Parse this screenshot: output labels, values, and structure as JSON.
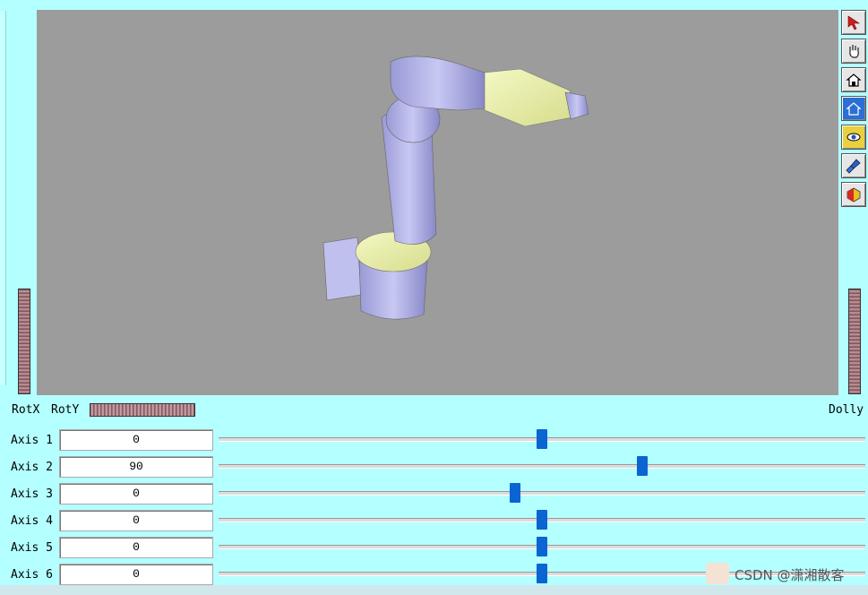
{
  "viewer": {
    "labels": {
      "rotx": "RotX",
      "roty": "RotY",
      "dolly": "Dolly"
    },
    "toolbar": [
      {
        "name": "select-arrow-icon"
      },
      {
        "name": "pan-hand-icon"
      },
      {
        "name": "home-icon"
      },
      {
        "name": "set-home-icon"
      },
      {
        "name": "view-all-eye-icon"
      },
      {
        "name": "seek-flashlight-icon"
      },
      {
        "name": "projection-cube-icon"
      }
    ]
  },
  "axes": [
    {
      "label": "Axis 1",
      "value": "0",
      "slider": 0.5
    },
    {
      "label": "Axis 2",
      "value": "90",
      "slider": 0.655
    },
    {
      "label": "Axis 3",
      "value": "0",
      "slider": 0.458
    },
    {
      "label": "Axis 4",
      "value": "0",
      "slider": 0.5
    },
    {
      "label": "Axis 5",
      "value": "0",
      "slider": 0.5
    },
    {
      "label": "Axis 6",
      "value": "0",
      "slider": 0.5
    }
  ],
  "watermark": {
    "text": "CSDN @潇湘散客"
  },
  "colors": {
    "arm": "#b4b4e8",
    "joint": "#eaf0a6",
    "viewport": "#9c9c9c",
    "slider_thumb": "#0a64d2"
  }
}
